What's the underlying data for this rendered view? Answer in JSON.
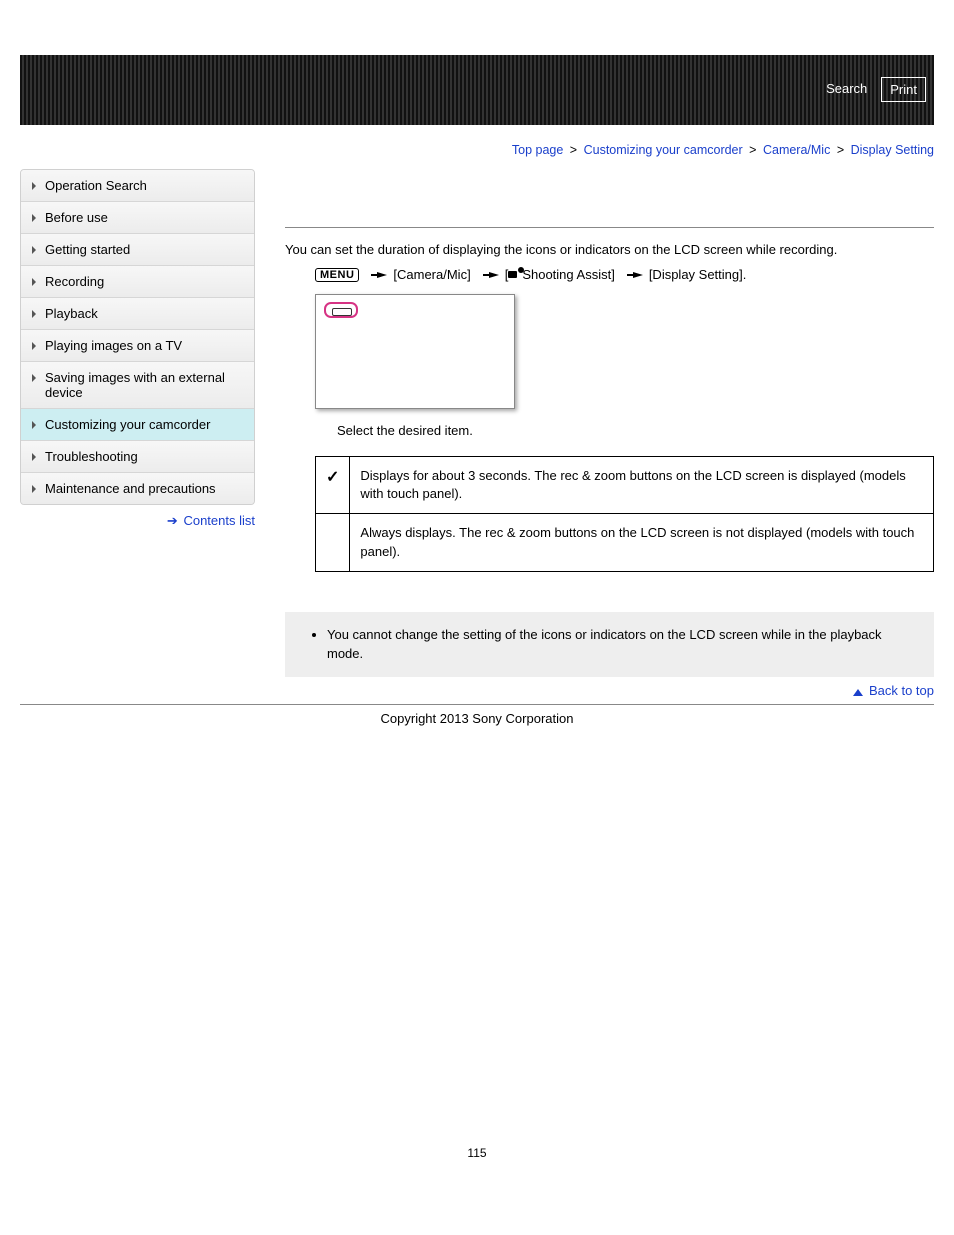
{
  "banner": {
    "search": "Search",
    "print": "Print"
  },
  "breadcrumb": {
    "top": "Top page",
    "cat": "Customizing your camcorder",
    "sub": "Camera/Mic",
    "leaf": "Display Setting"
  },
  "sidebar": {
    "items": [
      "Operation Search",
      "Before use",
      "Getting started",
      "Recording",
      "Playback",
      "Playing images on a TV",
      "Saving images with an external device",
      "Customizing your camcorder",
      "Troubleshooting",
      "Maintenance and precautions"
    ],
    "active_index": 7,
    "contents_link": "Contents list"
  },
  "main": {
    "intro": "You can set the duration of displaying the icons or indicators on the LCD screen while recording.",
    "menu_label": "MENU",
    "path_segments": {
      "a": "[Camera/Mic]",
      "b_prefix": "[",
      "b_text": "Shooting Assist]",
      "c": "[Display Setting]."
    },
    "step": "Select the desired item.",
    "options": [
      {
        "check": true,
        "text": "Displays for about 3 seconds. The rec & zoom buttons on the LCD screen is displayed (models with touch panel)."
      },
      {
        "check": false,
        "text": "Always displays. The rec & zoom buttons on the LCD screen is not displayed (models with touch panel)."
      }
    ],
    "note": "You cannot change the setting of the icons or indicators on the LCD screen while in the playback mode.",
    "back_to_top": "Back to top",
    "copyright": "Copyright 2013 Sony Corporation",
    "page_number": "115"
  }
}
